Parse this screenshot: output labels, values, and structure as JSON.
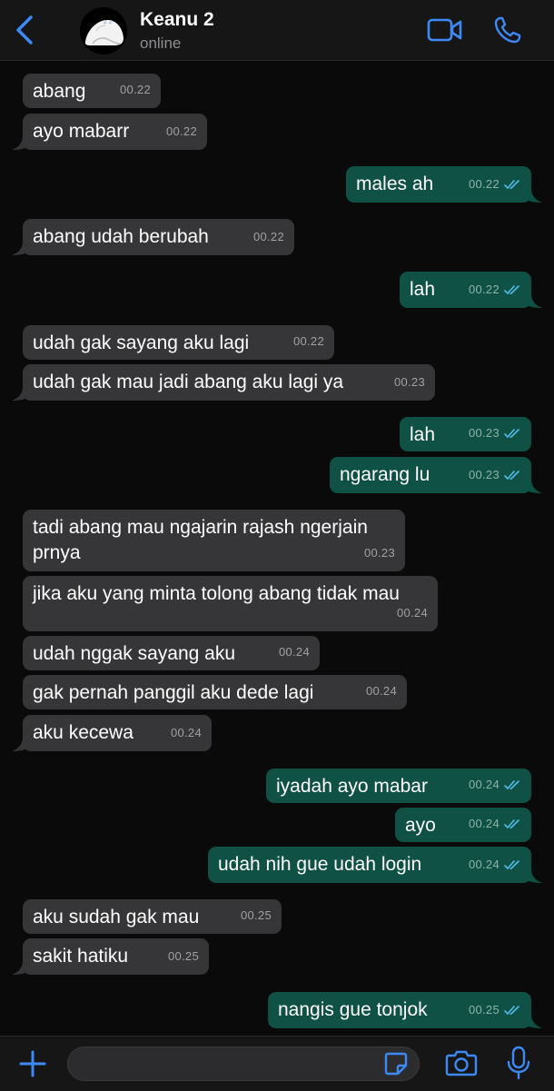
{
  "header": {
    "back_icon": "chevron-left-icon",
    "contact_name": "Keanu 2",
    "status": "online",
    "video_icon": "video-camera-icon",
    "phone_icon": "phone-icon"
  },
  "colors": {
    "accent": "#3d8af7",
    "incoming_bubble": "#363638",
    "outgoing_bubble": "#0f5144",
    "background": "#0a0a0a",
    "read_ticks": "#53bdeb"
  },
  "messages": [
    {
      "dir": "in",
      "text": "abang",
      "time": "00.22"
    },
    {
      "dir": "in",
      "text": "ayo mabarr",
      "time": "00.22"
    },
    {
      "dir": "out",
      "text": "males ah",
      "time": "00.22",
      "read": true
    },
    {
      "dir": "in",
      "text": "abang udah berubah",
      "time": "00.22"
    },
    {
      "dir": "out",
      "text": "lah",
      "time": "00.22",
      "read": true
    },
    {
      "dir": "in",
      "text": "udah gak sayang aku lagi",
      "time": "00.22"
    },
    {
      "dir": "in",
      "text": "udah gak mau jadi abang aku lagi ya",
      "time": "00.23"
    },
    {
      "dir": "out",
      "text": "lah",
      "time": "00.23",
      "read": true
    },
    {
      "dir": "out",
      "text": "ngarang lu",
      "time": "00.23",
      "read": true
    },
    {
      "dir": "in",
      "text": "tadi abang mau ngajarin rajash ngerjain prnya",
      "time": "00.23"
    },
    {
      "dir": "in",
      "text": "jika aku yang minta tolong abang tidak mau",
      "time": "00.24"
    },
    {
      "dir": "in",
      "text": "udah nggak sayang aku",
      "time": "00.24"
    },
    {
      "dir": "in",
      "text": "gak pernah panggil aku dede lagi",
      "time": "00.24"
    },
    {
      "dir": "in",
      "text": "aku kecewa",
      "time": "00.24"
    },
    {
      "dir": "out",
      "text": "iyadah ayo mabar",
      "time": "00.24",
      "read": true
    },
    {
      "dir": "out",
      "text": "ayo",
      "time": "00.24",
      "read": true
    },
    {
      "dir": "out",
      "text": "udah nih gue udah login",
      "time": "00.24",
      "read": true
    },
    {
      "dir": "in",
      "text": "aku sudah gak mau",
      "time": "00.25"
    },
    {
      "dir": "in",
      "text": "sakit hatiku",
      "time": "00.25"
    },
    {
      "dir": "out",
      "text": "nangis gue tonjok",
      "time": "00.25",
      "read": true
    }
  ],
  "footer": {
    "plus_icon": "plus-icon",
    "input_value": "",
    "sticker_icon": "sticker-icon",
    "camera_icon": "camera-icon",
    "mic_icon": "microphone-icon"
  }
}
